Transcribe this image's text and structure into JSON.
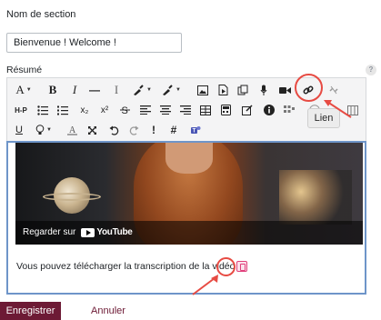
{
  "form": {
    "section_name_label": "Nom de section",
    "section_name_value": "Bienvenue ! Welcome !",
    "summary_label": "Résumé",
    "help_icon": "question-icon"
  },
  "toolbar": {
    "row1": {
      "font": "A",
      "bold": "B",
      "italic": "I",
      "dash": "—",
      "clear_format": "I"
    },
    "row2": {
      "h5p": "H-P",
      "subscript": "x₂",
      "superscript": "x²"
    },
    "row3": {
      "underline": "U",
      "nonbreak": "#"
    }
  },
  "editor": {
    "video_watch_text": "Regarder sur",
    "video_platform": "YouTube",
    "transcript_text": "Vous pouvez télécharger la transcription de la vidéo"
  },
  "tooltip": {
    "link": "Lien"
  },
  "actions": {
    "save": "Enregistrer",
    "cancel": "Annuler"
  },
  "colors": {
    "brand": "#6d1a35",
    "highlight": "#e74b43",
    "editor_border": "#6e95c9"
  }
}
